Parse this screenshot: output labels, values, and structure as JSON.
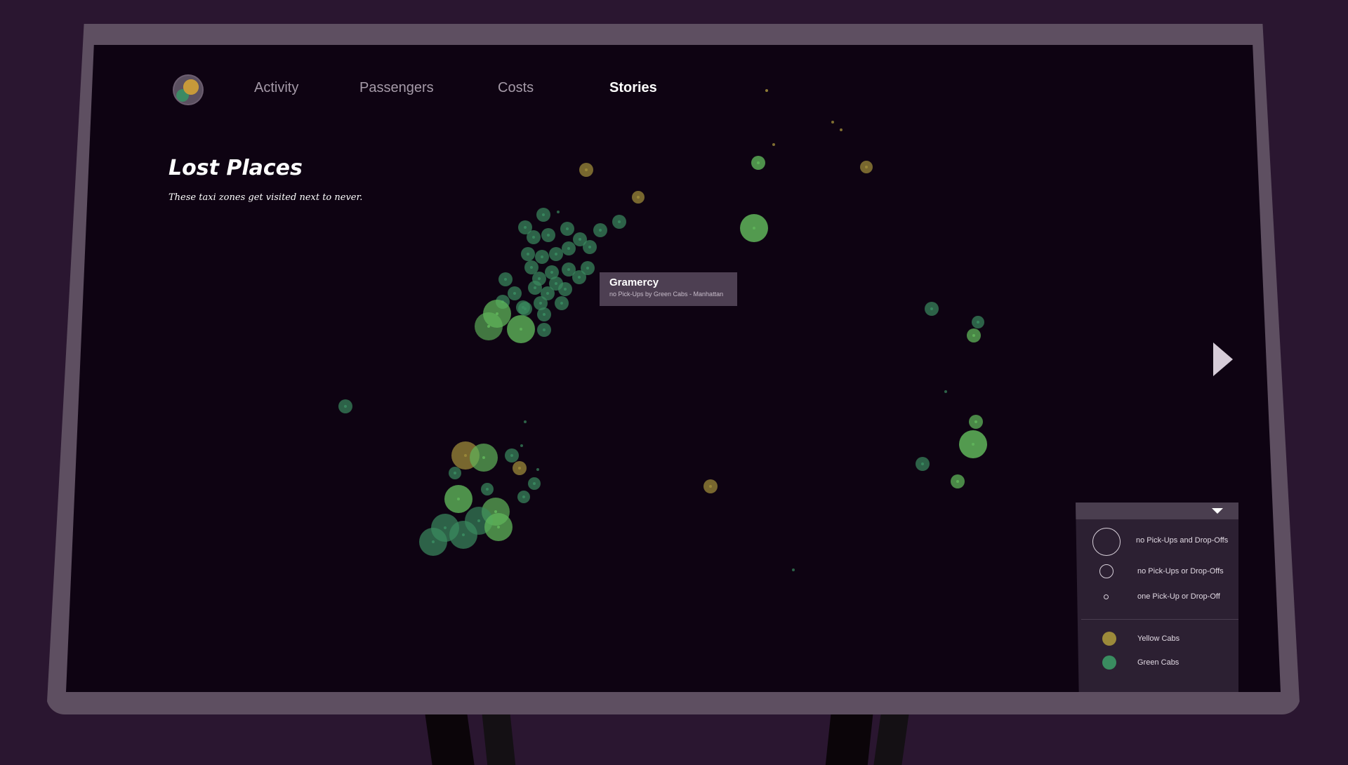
{
  "nav": {
    "items": [
      "Activity",
      "Passengers",
      "Costs",
      "Stories"
    ],
    "active": "Stories"
  },
  "story": {
    "title": "Lost Places",
    "subtitle": "These taxi zones get visited next to never."
  },
  "tooltip": {
    "zone": "Gramercy",
    "detail": "no Pick-Ups by Green Cabs - Manhattan"
  },
  "legend": {
    "size_items": [
      "no Pick-Ups and Drop-Offs",
      "no Pick-Ups or Drop-Offs",
      "one Pick-Up or Drop-Off"
    ],
    "color_items": [
      "Yellow Cabs",
      "Green Cabs"
    ]
  },
  "colors": {
    "yellow_cabs": "#9c8a3a",
    "green_cabs": "#3a8c60",
    "green_bright": "#5fb55a",
    "background": "#0e0312"
  },
  "icons": {
    "logo": "app-logo-icon",
    "next": "next-arrow-icon",
    "legend_toggle": "chevron-down-icon"
  }
}
